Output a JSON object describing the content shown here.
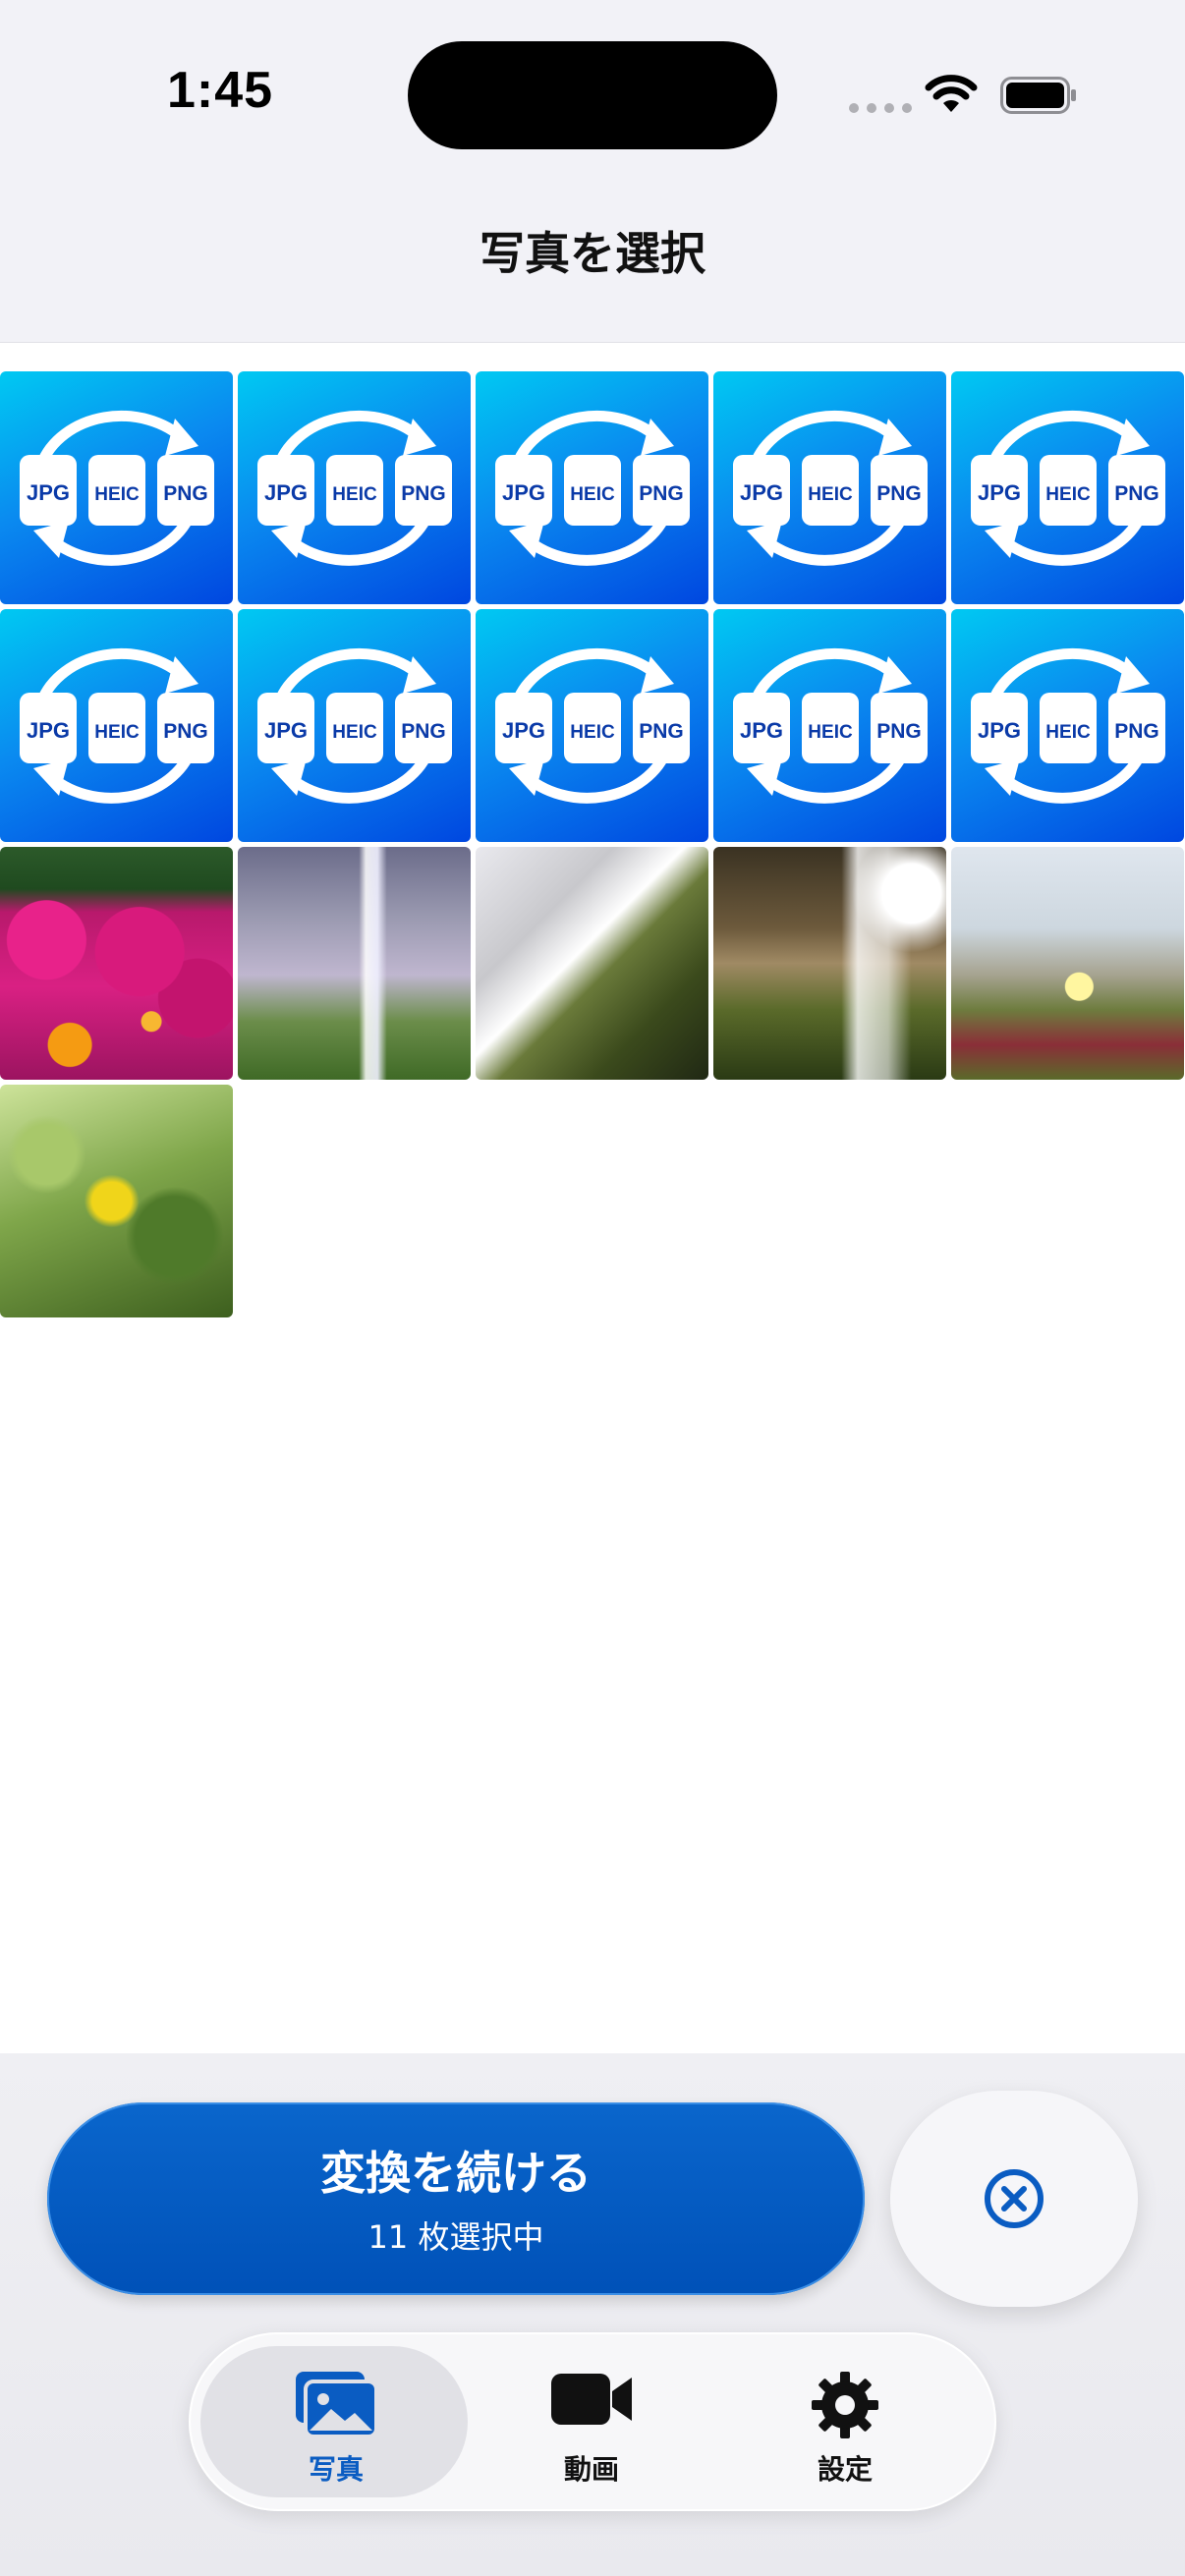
{
  "status": {
    "time": "1:45"
  },
  "header": {
    "title": "写真を選択"
  },
  "icon_labels": {
    "a": "JPG",
    "b": "HEIC",
    "c": "PNG"
  },
  "grid_items": [
    {
      "kind": "app-icon"
    },
    {
      "kind": "app-icon"
    },
    {
      "kind": "app-icon"
    },
    {
      "kind": "app-icon"
    },
    {
      "kind": "app-icon"
    },
    {
      "kind": "app-icon"
    },
    {
      "kind": "app-icon"
    },
    {
      "kind": "app-icon"
    },
    {
      "kind": "app-icon"
    },
    {
      "kind": "app-icon"
    },
    {
      "kind": "photo-flowers"
    },
    {
      "kind": "photo-waterfall1"
    },
    {
      "kind": "photo-waterfall2"
    },
    {
      "kind": "photo-waterfall3"
    },
    {
      "kind": "photo-plants"
    },
    {
      "kind": "photo-lemon"
    }
  ],
  "action": {
    "convert_title": "変換を続ける",
    "convert_sub": "11 枚選択中"
  },
  "tabs": [
    {
      "label": "写真",
      "icon": "photos-icon",
      "active": true
    },
    {
      "label": "動画",
      "icon": "video-icon",
      "active": false
    },
    {
      "label": "設定",
      "icon": "gear-icon",
      "active": false
    }
  ],
  "colors": {
    "accent": "#0A5CC2",
    "background": "#F2F2F7"
  }
}
